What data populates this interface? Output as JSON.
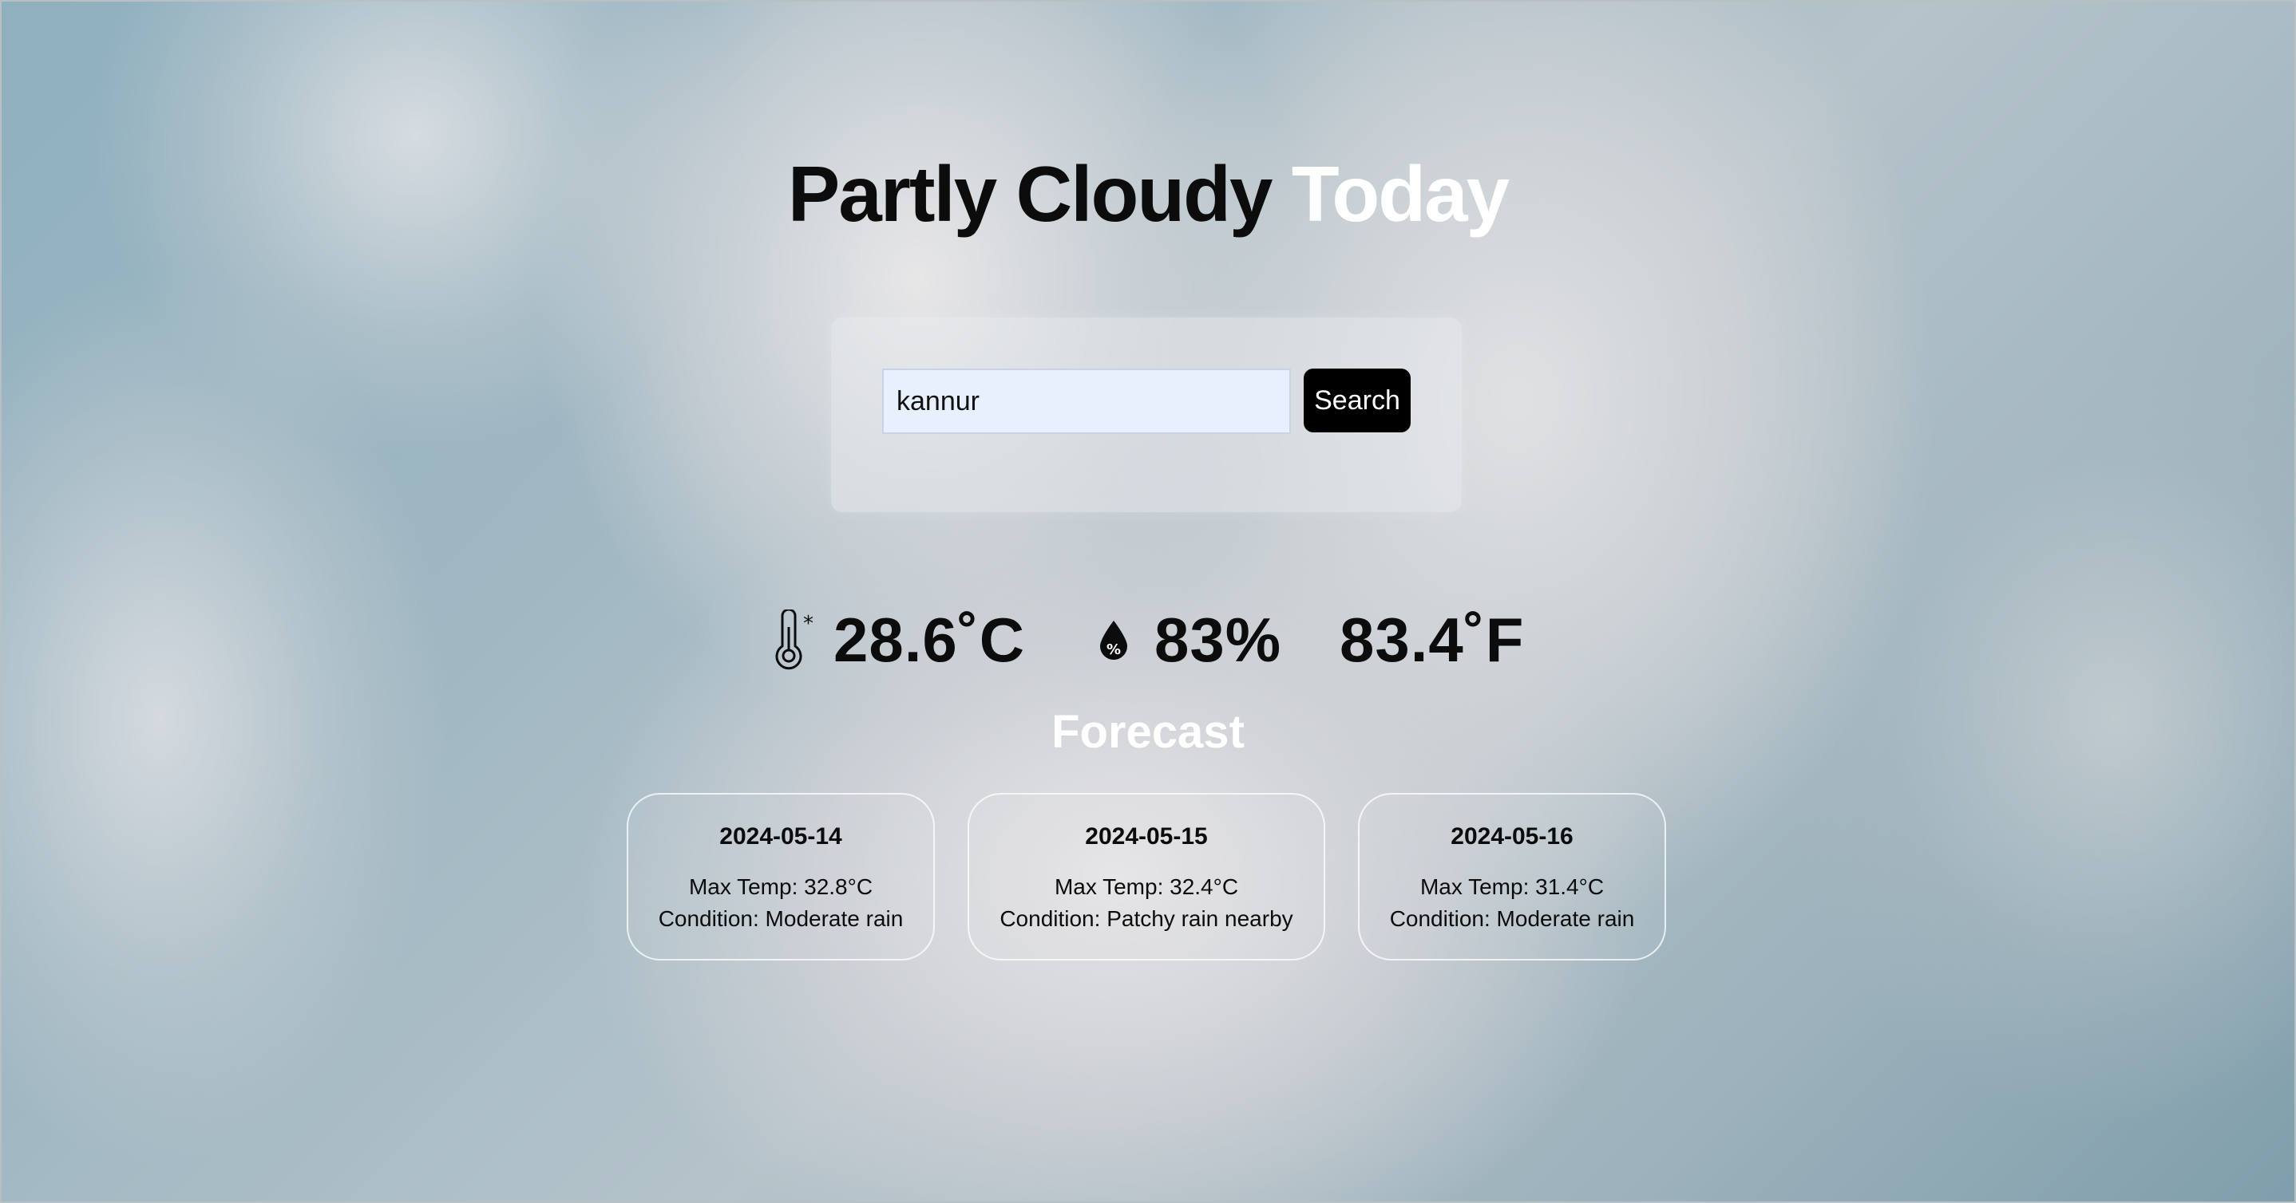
{
  "header": {
    "title_part1": "Partly Cloudy",
    "title_part2": "Today"
  },
  "search": {
    "value": "kannur",
    "button_label": "Search"
  },
  "current": {
    "temp_c": "28.6˚C",
    "humidity": "83%",
    "temp_f": "83.4˚F"
  },
  "forecast": {
    "title": "Forecast",
    "days": [
      {
        "date": "2024-05-14",
        "max_temp": "Max Temp: 32.8°C",
        "condition": "Condition: Moderate rain"
      },
      {
        "date": "2024-05-15",
        "max_temp": "Max Temp: 32.4°C",
        "condition": "Condition: Patchy rain nearby"
      },
      {
        "date": "2024-05-16",
        "max_temp": "Max Temp: 31.4°C",
        "condition": "Condition: Moderate rain"
      }
    ]
  },
  "icons": {
    "temperature": "thermometer-icon",
    "humidity": "humidity-drop-icon"
  },
  "colors": {
    "title_dark": "#0c0c0c",
    "title_light": "#ffffff",
    "input_bg": "#e8f0fe",
    "button_bg": "#000000"
  }
}
